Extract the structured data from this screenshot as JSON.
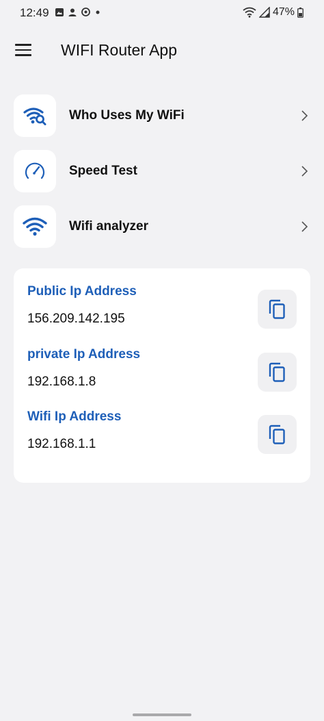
{
  "status_bar": {
    "time": "12:49",
    "battery": "47%",
    "icons": [
      "gallery-icon",
      "person-icon",
      "sync-icon",
      "dot-icon",
      "wifi-icon",
      "signal-icon",
      "battery-icon"
    ]
  },
  "app_bar": {
    "title": "WIFI Router App",
    "menu_icon": "hamburger-icon"
  },
  "menu": {
    "items": [
      {
        "label": "Who Uses My WiFi",
        "icon": "wifi-search-icon"
      },
      {
        "label": "Speed Test",
        "icon": "speedometer-icon"
      },
      {
        "label": "Wifi analyzer",
        "icon": "wifi-icon"
      }
    ]
  },
  "ip_info": {
    "items": [
      {
        "label": "Public Ip Address",
        "value": "156.209.142.195"
      },
      {
        "label": "private Ip Address",
        "value": "192.168.1.8"
      },
      {
        "label": "Wifi Ip Address",
        "value": "192.168.1.1"
      }
    ]
  },
  "colors": {
    "accent": "#1e5fb8",
    "background": "#f2f2f4",
    "card": "#ffffff",
    "copy_button_bg": "#f0f0f2"
  }
}
